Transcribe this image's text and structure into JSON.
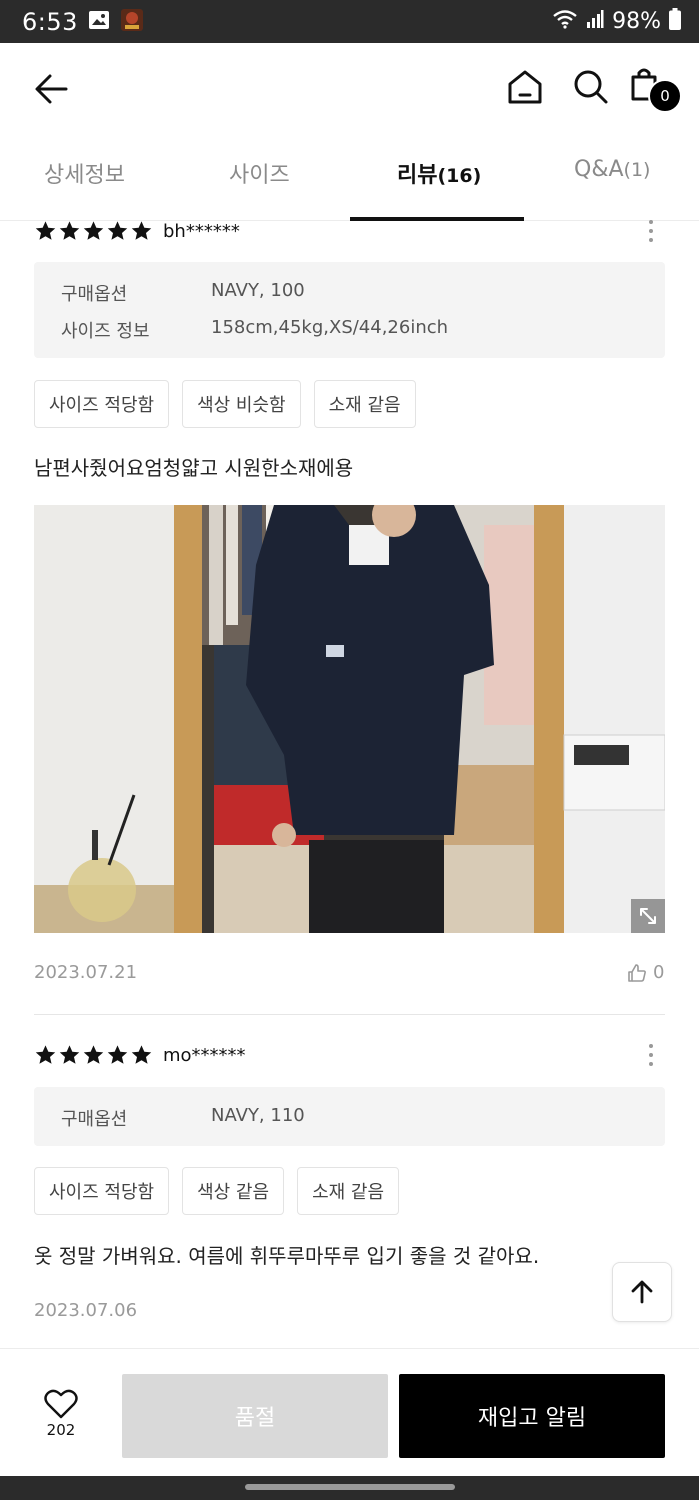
{
  "status": {
    "time": "6:53",
    "battery": "98%"
  },
  "header": {
    "cart_count": "0"
  },
  "tabs": [
    {
      "label": "상세정보",
      "count": ""
    },
    {
      "label": "사이즈",
      "count": ""
    },
    {
      "label": "리뷰",
      "count": "(16)"
    },
    {
      "label": "Q&A",
      "count": "(1)"
    }
  ],
  "reviews": [
    {
      "rating": 5,
      "reviewer": "bh******",
      "option_label": "구매옵션",
      "option_value": "NAVY, 100",
      "size_label": "사이즈 정보",
      "size_value": "158cm,45kg,XS/44,26inch",
      "tags": [
        "사이즈 적당함",
        "색상 비슷함",
        "소재 같음"
      ],
      "text": "남편사줬어요엄청얇고 시원한소재에용",
      "date": "2023.07.21",
      "likes": "0"
    },
    {
      "rating": 5,
      "reviewer": "mo******",
      "option_label": "구매옵션",
      "option_value": "NAVY, 110",
      "tags": [
        "사이즈 적당함",
        "색상 같음",
        "소재 같음"
      ],
      "text": "옷 정말 가벼워요. 여름에 휘뚜루마뚜루 입기 좋을 것 같아요.",
      "date": "2023.07.06"
    }
  ],
  "bottom": {
    "wish_count": "202",
    "soldout_label": "품절",
    "restock_label": "재입고 알림"
  }
}
